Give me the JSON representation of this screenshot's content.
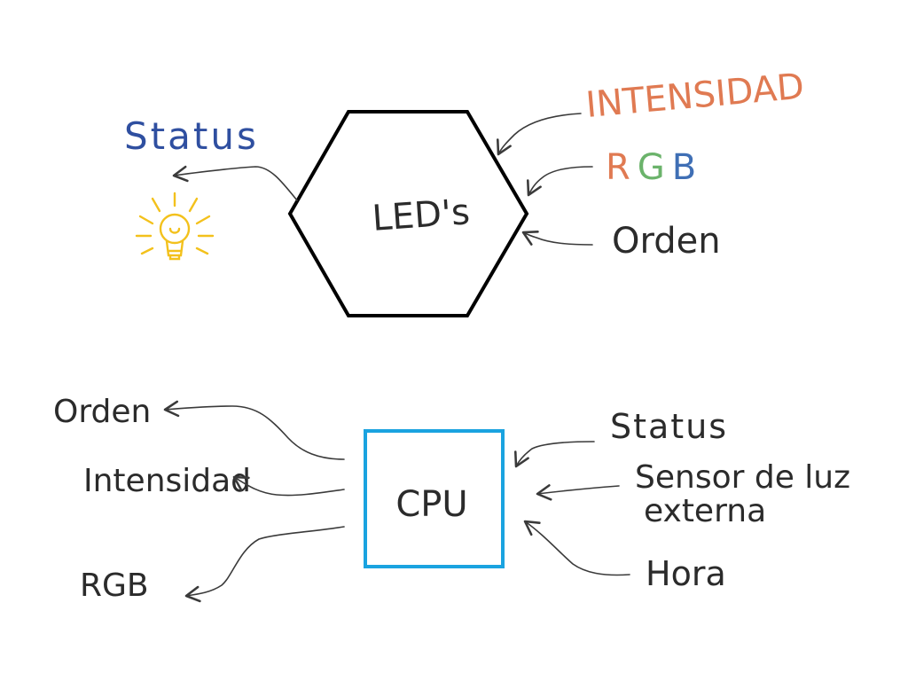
{
  "colors": {
    "ink": "#2b2b2b",
    "status_top": "#2f4fa0",
    "intensidad_top": "#e07a52",
    "rgb_r": "#e07a52",
    "rgb_g": "#6bb36b",
    "rgb_b": "#3f6fb5",
    "cpu_box": "#1aa3e0",
    "bulb": "#f3c11c",
    "hexagon": "#000000"
  },
  "led_block": {
    "label": "LED's",
    "left_output": "Status",
    "bulb_icon": "lightbulb-icon",
    "inputs": {
      "intensidad": "INTENSIDAD",
      "rgb_r": "R",
      "rgb_g": "G",
      "rgb_b": "B",
      "orden": "Orden"
    }
  },
  "cpu_block": {
    "label": "CPU",
    "outputs": {
      "orden": "Orden",
      "intensidad": "Intensidad",
      "rgb": "RGB"
    },
    "inputs": {
      "status": "Status",
      "sensor_line1": "Sensor de luz",
      "sensor_line2": "externa",
      "hora": "Hora"
    }
  }
}
